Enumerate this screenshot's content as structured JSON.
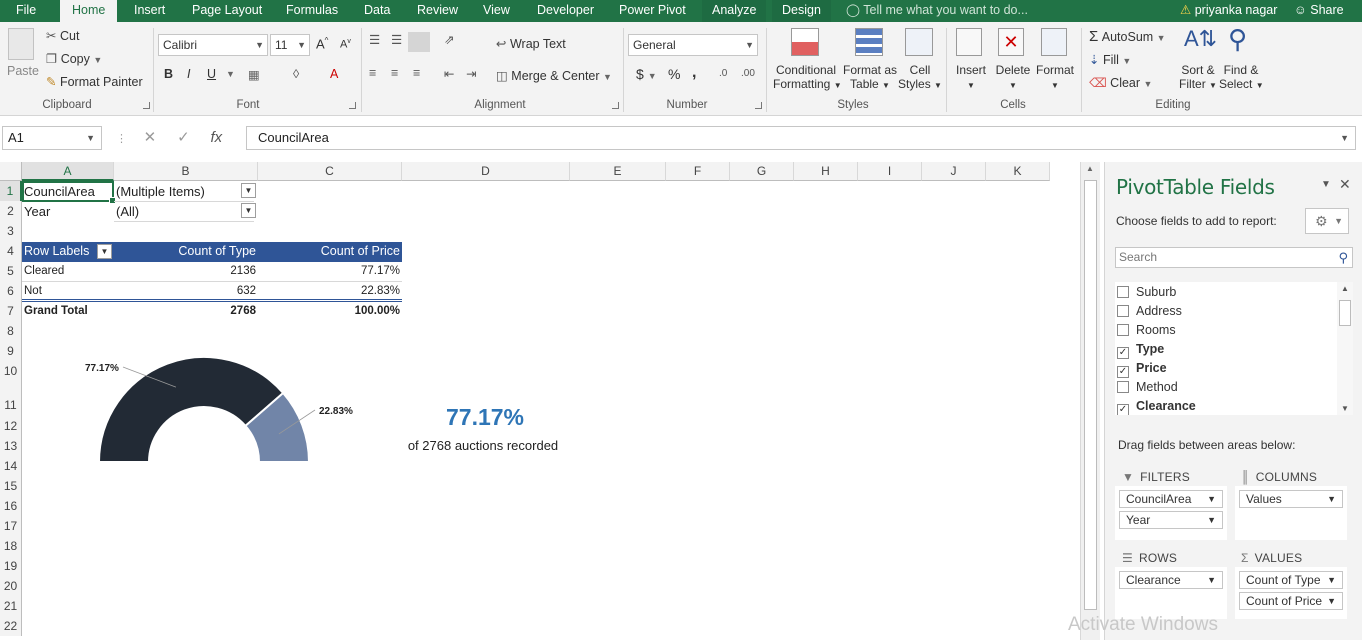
{
  "tabs": {
    "file": "File",
    "home": "Home",
    "insert": "Insert",
    "page_layout": "Page Layout",
    "formulas": "Formulas",
    "data": "Data",
    "review": "Review",
    "view": "View",
    "developer": "Developer",
    "power_pivot": "Power Pivot",
    "analyze": "Analyze",
    "design": "Design",
    "tell_me": "Tell me what you want to do...",
    "user": "priyanka nagar",
    "share": "Share"
  },
  "ribbon": {
    "clipboard": {
      "paste": "Paste",
      "cut": "Cut",
      "copy": "Copy",
      "format_painter": "Format Painter",
      "label": "Clipboard"
    },
    "font": {
      "name": "Calibri",
      "size": "11",
      "label": "Font",
      "bold": "B",
      "italic": "I",
      "underline": "U"
    },
    "alignment": {
      "wrap": "Wrap Text",
      "merge": "Merge & Center",
      "label": "Alignment"
    },
    "number": {
      "format": "General",
      "label": "Number",
      "currency": "$",
      "percent": "%",
      "comma": ","
    },
    "styles": {
      "conditional": "Conditional",
      "conditional2": "Formatting",
      "format_as": "Format as",
      "format_as2": "Table",
      "cell": "Cell",
      "cell2": "Styles",
      "label": "Styles"
    },
    "cells": {
      "insert": "Insert",
      "delete": "Delete",
      "format": "Format",
      "label": "Cells"
    },
    "editing": {
      "autosum": "AutoSum",
      "fill": "Fill",
      "clear": "Clear",
      "sort": "Sort &",
      "sort2": "Filter",
      "find": "Find &",
      "find2": "Select",
      "label": "Editing"
    }
  },
  "formula_bar": {
    "name_box": "A1",
    "content": "CouncilArea"
  },
  "columns": [
    "A",
    "B",
    "C",
    "D",
    "E",
    "F",
    "G",
    "H",
    "I",
    "J",
    "K"
  ],
  "rows": [
    "1",
    "2",
    "3",
    "4",
    "5",
    "6",
    "7",
    "8",
    "9",
    "10",
    "11",
    "12",
    "13",
    "14",
    "15",
    "16",
    "17",
    "18",
    "19",
    "20",
    "21",
    "22"
  ],
  "sheet": {
    "a1": "CouncilArea",
    "b1": "(Multiple Items)",
    "a2": "Year",
    "b2": "(All)",
    "hdr_a": "Row Labels",
    "hdr_b": "Count of Type",
    "hdr_c": "Count of Price",
    "r5_a": "Cleared",
    "r5_b": "2136",
    "r5_c": "77.17%",
    "r6_a": "Not",
    "r6_b": "632",
    "r6_c": "22.83%",
    "r7_a": "Grand Total",
    "r7_b": "2768",
    "r7_c": "100.00%"
  },
  "chart_data": {
    "type": "pie",
    "categories": [
      "Cleared",
      "Not"
    ],
    "values": [
      77.17,
      22.83
    ],
    "data_labels": [
      "77.17%",
      "22.83%"
    ],
    "colors": [
      "#222a35",
      "#7185a8"
    ]
  },
  "kpi": {
    "value": "77.17%",
    "caption": "of 2768 auctions recorded"
  },
  "pivot_pane": {
    "title": "PivotTable Fields",
    "choose": "Choose fields to add to report:",
    "search_placeholder": "Search",
    "fields": [
      {
        "name": "Suburb",
        "checked": false
      },
      {
        "name": "Address",
        "checked": false
      },
      {
        "name": "Rooms",
        "checked": false
      },
      {
        "name": "Type",
        "checked": true
      },
      {
        "name": "Price",
        "checked": true
      },
      {
        "name": "Method",
        "checked": false
      },
      {
        "name": "Clearance",
        "checked": true
      }
    ],
    "drag_hint": "Drag fields between areas below:",
    "filters_label": "FILTERS",
    "columns_label": "COLUMNS",
    "rows_label": "ROWS",
    "values_label": "VALUES",
    "filters": [
      "CouncilArea",
      "Year"
    ],
    "columns": [
      "Values"
    ],
    "rows": [
      "Clearance"
    ],
    "values": [
      "Count of Type",
      "Count of Price"
    ]
  },
  "watermark": "Activate Windows"
}
